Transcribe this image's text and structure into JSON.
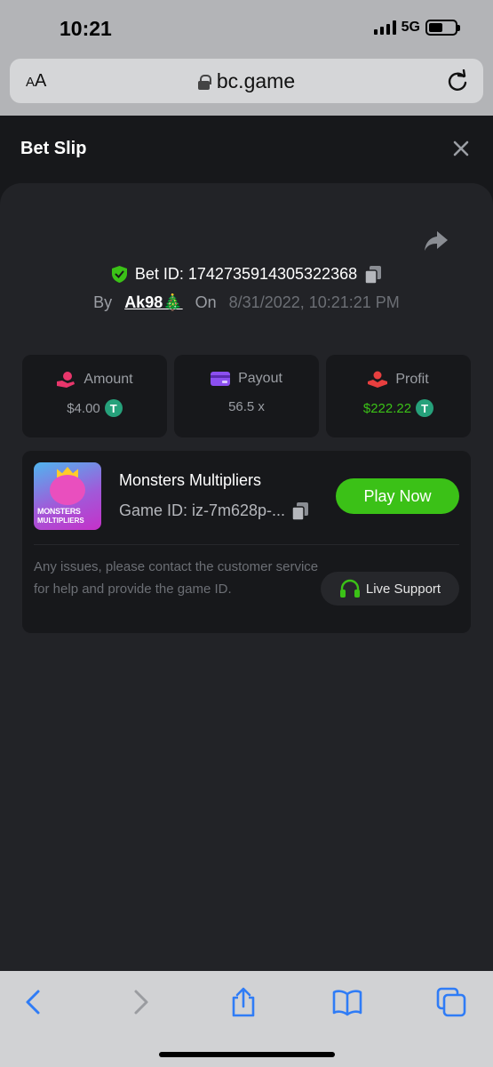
{
  "status_bar": {
    "time": "10:21",
    "network": "5G",
    "icons": [
      "signal-icon",
      "battery-icon"
    ]
  },
  "browser": {
    "text_size_label_small": "A",
    "text_size_label_large": "A",
    "url": "bc.game",
    "icons": [
      "lock-icon",
      "reload-icon"
    ]
  },
  "modal": {
    "title": "Bet Slip",
    "bet_id_label": "Bet ID: 1742735914305322368",
    "by_label": "By",
    "username": "Ak98🎄",
    "on_label": "On",
    "date": "8/31/2022, 10:21:21 PM"
  },
  "stats": [
    {
      "label": "Amount",
      "value": "$4.00",
      "icon": "hand-coin-icon",
      "currency_icon": "tether-icon"
    },
    {
      "label": "Payout",
      "value": "56.5 x",
      "icon": "card-icon"
    },
    {
      "label": "Profit",
      "value": "$222.22",
      "icon": "hand-profit-icon",
      "currency_icon": "tether-icon"
    }
  ],
  "game": {
    "name": "Monsters Multipliers",
    "game_id": "Game ID: iz-7m628p-...",
    "thumb_line1": "MONSTERS",
    "thumb_line2": "MULTIPLIERS",
    "play_label": "Play Now",
    "issue_text": "Any issues, please contact the customer service for help and provide the game ID.",
    "support_label": "Live Support"
  },
  "colors": {
    "accent_green": "#3bc117",
    "tether": "#26a17b",
    "amount_icon": "#e8366b",
    "payout_icon": "#8b4ff0",
    "profit_icon": "#e83f3f"
  },
  "toolbar": {
    "icons": [
      "back-icon",
      "forward-icon",
      "share-icon",
      "bookmarks-icon",
      "tabs-icon"
    ]
  }
}
